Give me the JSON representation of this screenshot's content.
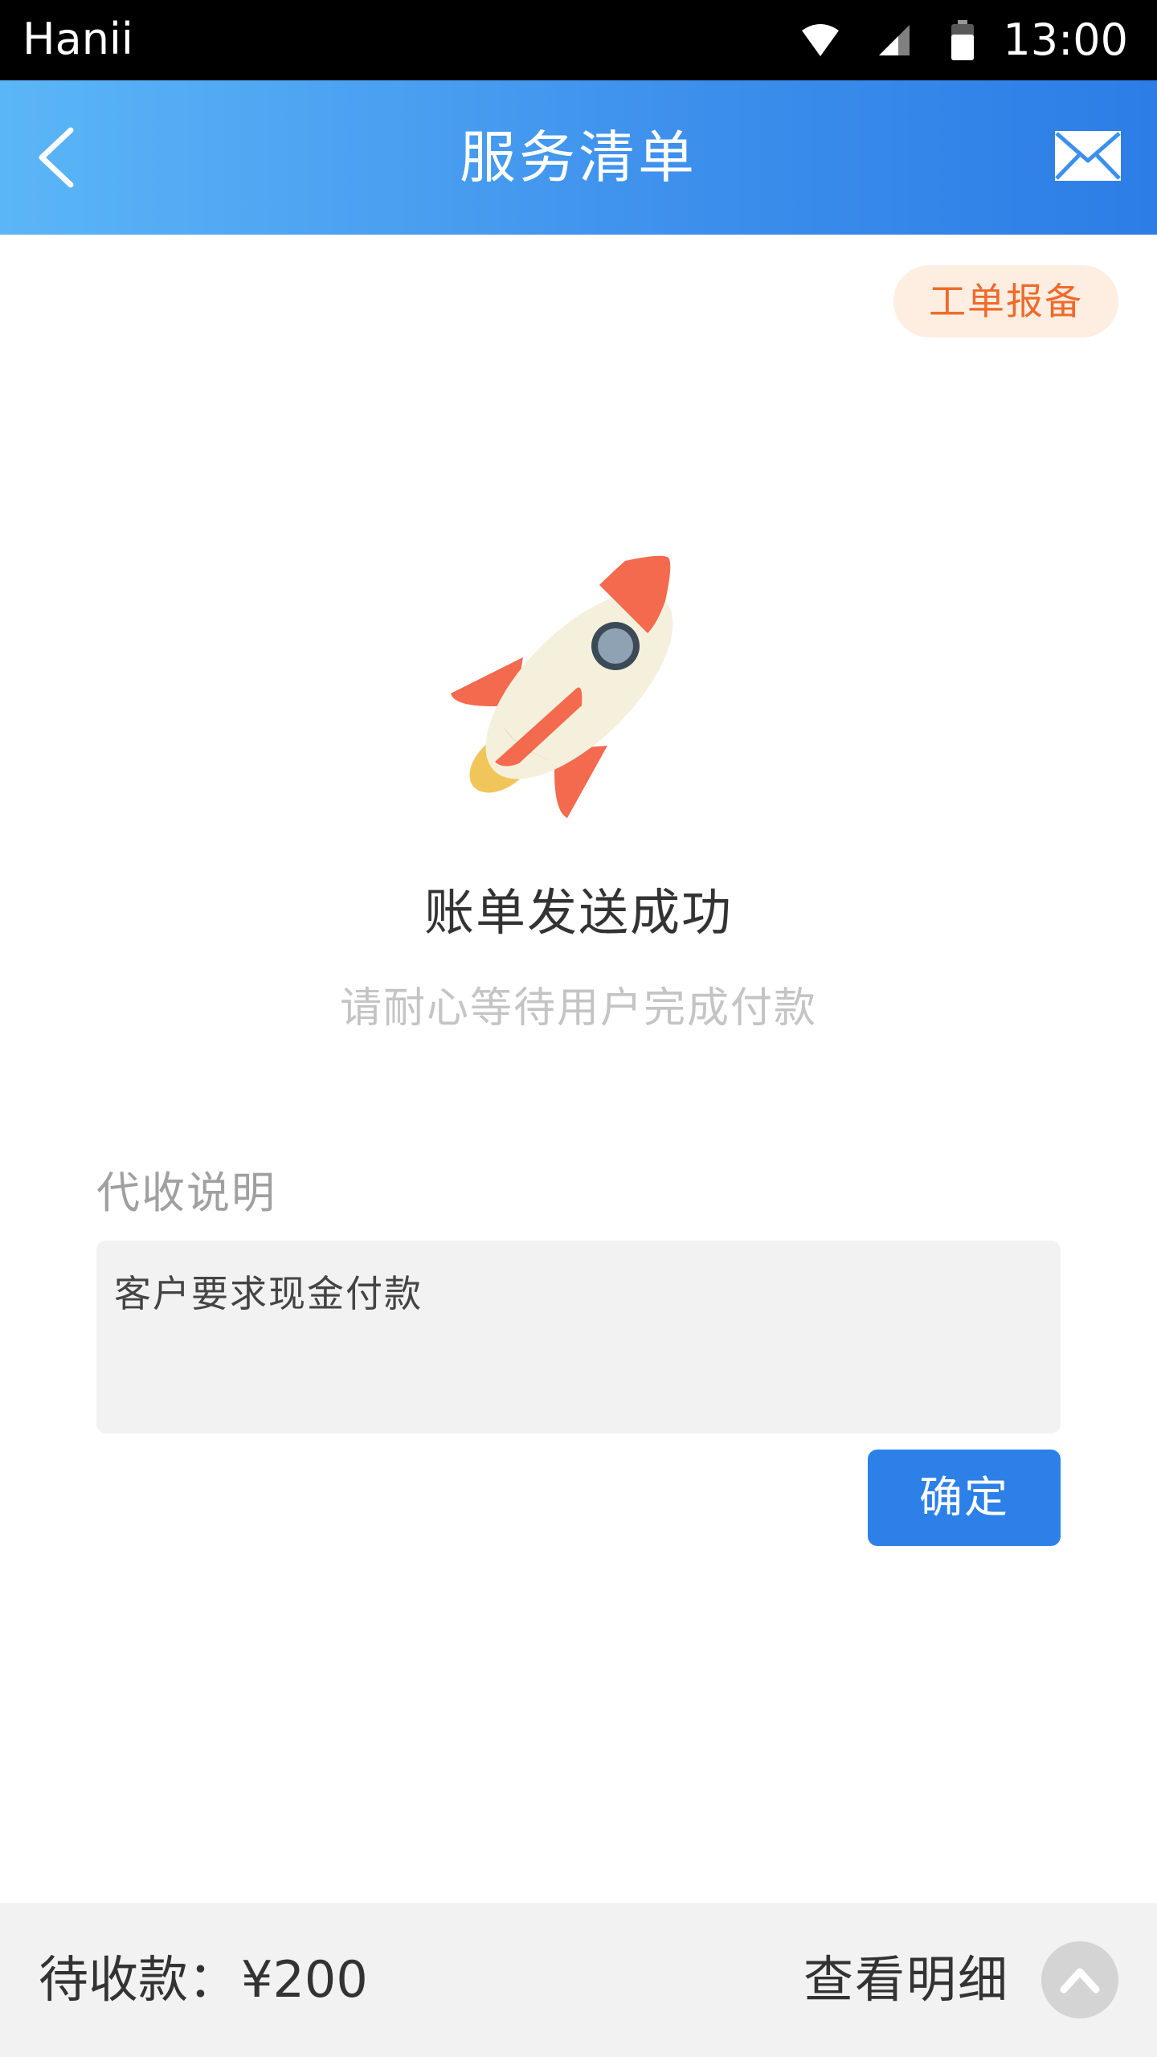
{
  "status_bar": {
    "carrier": "Hanii",
    "time": "13:00"
  },
  "header": {
    "title": "服务清单",
    "back_icon": "chevron-left-icon",
    "mail_icon": "mail-icon"
  },
  "report_button_label": "工单报备",
  "result": {
    "illustration": "rocket",
    "title": "账单发送成功",
    "subtitle": "请耐心等待用户完成付款"
  },
  "note": {
    "label": "代收说明",
    "value": "客户要求现金付款"
  },
  "confirm_label": "确定",
  "footer": {
    "pending_label": "待收款：",
    "pending_amount": "¥200",
    "details_label": "查看明细",
    "expand_icon": "chevron-up-icon"
  },
  "colors": {
    "header_start": "#5bb6f7",
    "header_end": "#2c7de6",
    "accent": "#2c80e7",
    "report_text": "#ef6a2b",
    "report_bg": "#fdeee1"
  }
}
